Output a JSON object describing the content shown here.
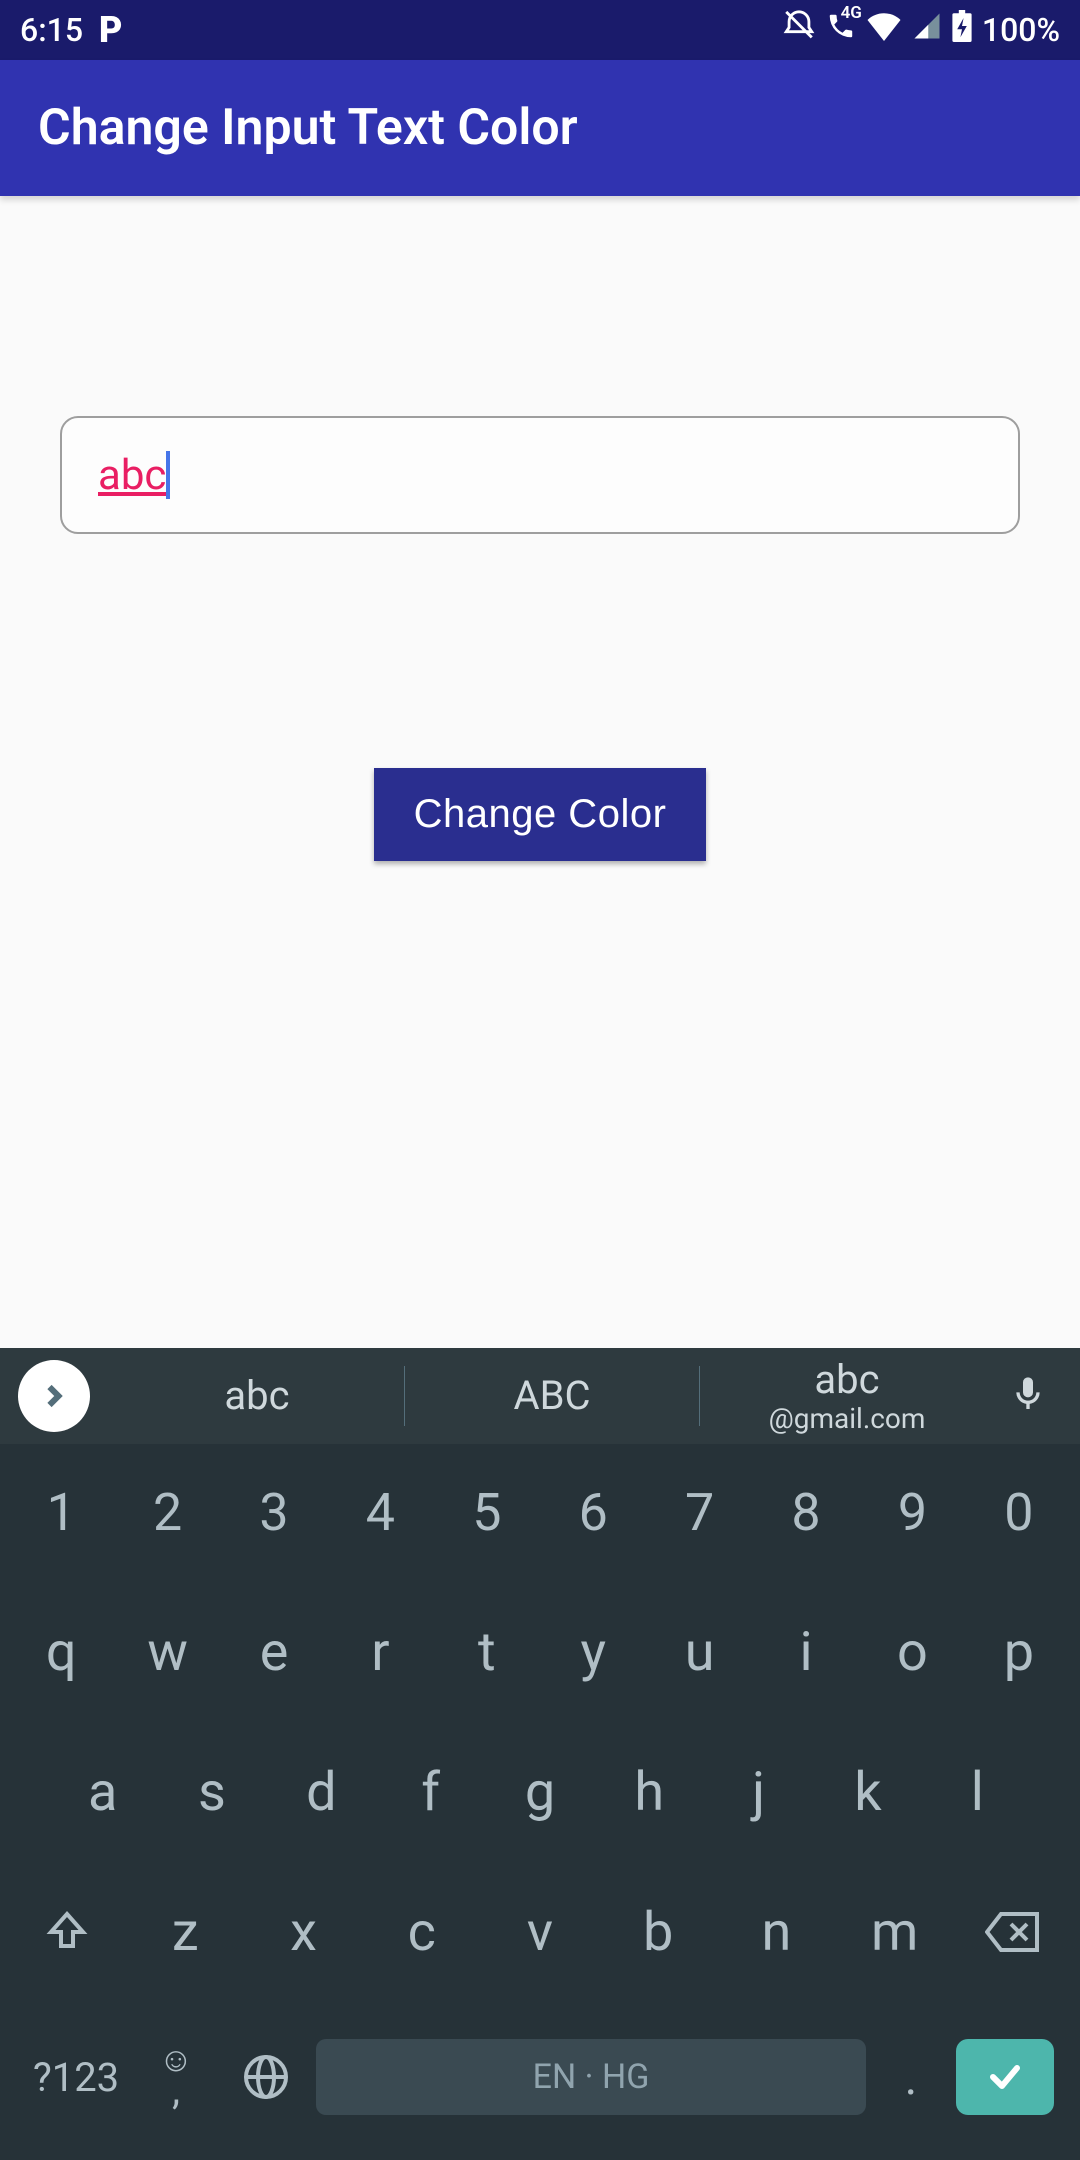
{
  "status": {
    "time": "6:15",
    "p_icon": "P",
    "battery": "100%",
    "fourG": "4G"
  },
  "appbar": {
    "title": "Change Input Text Color"
  },
  "input": {
    "value": "abc"
  },
  "button": {
    "label": "Change Color"
  },
  "keyboard": {
    "suggestions": [
      {
        "main": "abc",
        "sub": ""
      },
      {
        "main": "ABC",
        "sub": ""
      },
      {
        "main": "abc",
        "sub": "@gmail.com"
      }
    ],
    "row1": [
      "1",
      "2",
      "3",
      "4",
      "5",
      "6",
      "7",
      "8",
      "9",
      "0"
    ],
    "row2": [
      "q",
      "w",
      "e",
      "r",
      "t",
      "y",
      "u",
      "i",
      "o",
      "p"
    ],
    "row3": [
      "a",
      "s",
      "d",
      "f",
      "g",
      "h",
      "j",
      "k",
      "l"
    ],
    "row4": [
      "z",
      "x",
      "c",
      "v",
      "b",
      "n",
      "m"
    ],
    "sym": "?123",
    "comma": ",",
    "space": "EN · HG",
    "period": "."
  }
}
